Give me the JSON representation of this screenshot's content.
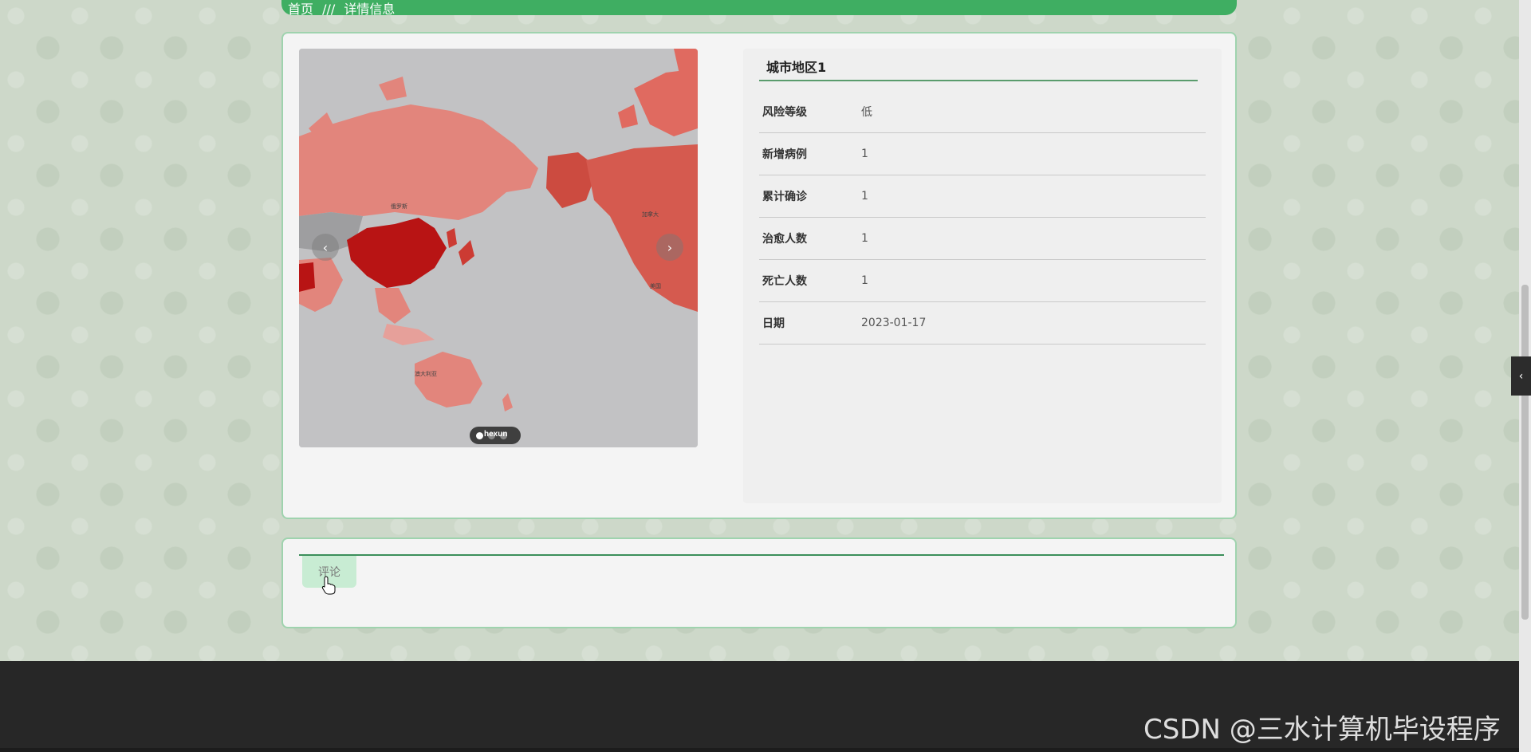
{
  "breadcrumb": {
    "home": "首页",
    "separator": "///",
    "current": "详情信息"
  },
  "carousel": {
    "prev_label": "‹",
    "next_label": "›",
    "watermark": "hexun",
    "slide_count": 3,
    "active_slide": 1
  },
  "detail": {
    "title": "城市地区1",
    "rows": [
      {
        "label": "风险等级",
        "value": "低"
      },
      {
        "label": "新增病例",
        "value": "1"
      },
      {
        "label": "累计确诊",
        "value": "1"
      },
      {
        "label": "治愈人数",
        "value": "1"
      },
      {
        "label": "死亡人数",
        "value": "1"
      },
      {
        "label": "日期",
        "value": "2023-01-17"
      }
    ]
  },
  "comment": {
    "tab_label": "评论"
  },
  "side_toggle_label": "‹",
  "footer": {
    "watermark": "CSDN @三水计算机毕设程序"
  },
  "colors": {
    "accent": "#3fae62",
    "card_border": "#9fd3ae",
    "map_dark": "#b81414",
    "map_light": "#e2857c"
  }
}
